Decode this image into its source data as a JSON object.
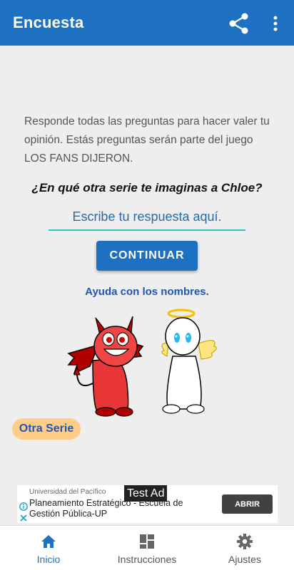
{
  "appbar": {
    "title": "Encuesta",
    "share_icon": "share-icon",
    "menu_icon": "more-vert-icon",
    "color": "#1e70c0"
  },
  "intro": "Responde todas las preguntas para hacer valer tu opinión. Estás preguntas serán parte del juego LOS FANS DIJERON.",
  "question": "¿En qué otra serie te imaginas a Chloe?",
  "answer": {
    "value": "",
    "placeholder": "Escribe tu respuesta aquí."
  },
  "continue_label": "CONTINUAR",
  "help_link": "Ayuda con los nombres.",
  "other_series_label": "Otra Serie",
  "ad": {
    "advertiser": "Universidad del Pacífico",
    "title": "Planeamiento Estratégico - Escuela de Gestión Pública-UP",
    "button_label": "ABRIR",
    "test_label": "Test Ad"
  },
  "nav": {
    "items": [
      {
        "label": "Inicio",
        "icon": "home-icon",
        "active": true
      },
      {
        "label": "Instrucciones",
        "icon": "dashboard-icon",
        "active": false
      },
      {
        "label": "Ajustes",
        "icon": "gear-icon",
        "active": false
      }
    ]
  }
}
